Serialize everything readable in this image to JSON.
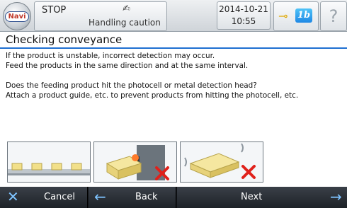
{
  "header": {
    "status": "STOP",
    "caution_label": "Handling caution",
    "date": "2014-10-21",
    "time": "10:55",
    "level_badge": "1b",
    "help": "?"
  },
  "title": "Checking conveyance",
  "lines": [
    "If the product is unstable, incorrect detection may occur.",
    "Feed the products in the same direction and at the same interval.",
    "Does the feeding product hit the photocell or metal detection head?",
    "Attach a product guide, etc. to prevent products from hitting the photocell, etc."
  ],
  "buttons": {
    "cancel": "Cancel",
    "back": "Back",
    "next": "Next"
  },
  "icons": {
    "navi": "navi-logo",
    "caution": "caution-icon",
    "key": "key-icon",
    "cancel": "x-icon",
    "back": "arrow-left-icon",
    "next": "arrow-right-icon"
  },
  "colors": {
    "accent": "#1f6fd1",
    "x_mark": "#e0211b"
  }
}
